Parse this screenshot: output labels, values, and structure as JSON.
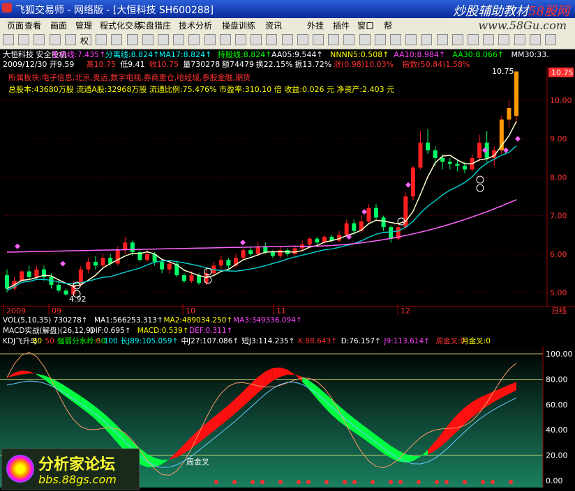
{
  "window": {
    "title": "飞狐交易师 - 网络版 - [大恒科技 SH600288]",
    "watermark_a": "炒股辅助教材",
    "watermark_b": "58股网"
  },
  "menu": {
    "items": [
      "页面",
      "查看",
      "画面",
      "管理",
      "程式化交易",
      "实盘猎庄",
      "技术分析",
      "操盘训练",
      "资讯",
      "外挂",
      "插件",
      "窗口",
      "帮"
    ],
    "url": "www.58Gu.com"
  },
  "toolbar": {
    "quanlabel": "权"
  },
  "header": {
    "line1": [
      {
        "t": "大恒科技 安全投机",
        "c": "#ffffff"
      },
      {
        "t": "生命线:7.435↑",
        "c": "#ff44ff"
      },
      {
        "t": "分离线:8.824↑",
        "c": "#00ffff"
      },
      {
        "t": "MA17:8.824↑",
        "c": "#00ffff"
      },
      {
        "t": "持股线:8.824↑",
        "c": "#00ff00"
      },
      {
        "t": "AA05:9.544↑",
        "c": "#ffffff"
      },
      {
        "t": "NNNN5:0.508↑",
        "c": "#ffff00"
      },
      {
        "t": "AA10:8.984↑",
        "c": "#ff44ff"
      },
      {
        "t": "AA30:8.066↑",
        "c": "#00ff00"
      },
      {
        "t": "MM30:33.",
        "c": "#ffffff"
      }
    ],
    "line2": [
      {
        "t": "2009/12/30 开9.59",
        "c": "#ffffff"
      },
      {
        "t": "高10.75",
        "c": "#ff3030"
      },
      {
        "t": "低9.41",
        "c": "#ffffff"
      },
      {
        "t": "收10.75",
        "c": "#ff3030"
      },
      {
        "t": "量730278",
        "c": "#ffffff"
      },
      {
        "t": "额74479",
        "c": "#ffffff"
      },
      {
        "t": "换22.15%",
        "c": "#ffffff"
      },
      {
        "t": "振13.72%",
        "c": "#ffffff"
      },
      {
        "t": "涨(0.98)10.03%",
        "c": "#ff3030"
      },
      {
        "t": "指数(50.84)1.58%",
        "c": "#ff3030"
      }
    ],
    "line3": "所属板块:电子信息,北京,奥运,数字电视,券商重仓,哈经城,参股金融,期货",
    "line4": "总股本:43680万股   流通A股:32968万股   流通比例:75.476%   市盈率:310.10 倍   收益:0.026 元   净资产:2.403 元"
  },
  "price_axis": {
    "labels": [
      "10.00",
      "9.00",
      "8.00",
      "7.00",
      "6.00",
      "5.00"
    ],
    "current": "10.75"
  },
  "annotations": {
    "high": "10.75",
    "low": "4.92"
  },
  "time_axis": {
    "labels": [
      "2009",
      "09",
      "10",
      "11",
      "12"
    ],
    "right": "日线"
  },
  "indicators": {
    "vol": [
      {
        "t": "VOL(5,10,35) 730278↑",
        "c": "#ffffff"
      },
      {
        "t": "MA1:566253.313↑",
        "c": "#ffffff"
      },
      {
        "t": "MA2:489034.250↑",
        "c": "#ffff00"
      },
      {
        "t": "MA3:349336.094↑",
        "c": "#ff44ff"
      }
    ],
    "macd": [
      {
        "t": "MACD实战(解盘)(26,12,9)",
        "c": "#ffffff"
      },
      {
        "t": "DIF:0.695↑",
        "c": "#ffffff"
      },
      {
        "t": "MACD:0.539↑",
        "c": "#ffff00"
      },
      {
        "t": "DEF:0.311↑",
        "c": "#ff44ff"
      }
    ],
    "kdj": [
      {
        "t": "KDJ飞升马",
        "c": "#ffffff"
      },
      {
        "t": "80",
        "c": "#ffff00"
      },
      {
        "t": "50",
        "c": "#ff3030"
      },
      {
        "t": "强弱分水岭:50",
        "c": "#00ff00"
      },
      {
        "t": "0",
        "c": "#ff3030"
      },
      {
        "t": "100",
        "c": "#00ffff"
      },
      {
        "t": "长J89:105.059↑",
        "c": "#00ffff"
      },
      {
        "t": "中J27:107.086↑",
        "c": "#ffffff"
      },
      {
        "t": "短J3:114.235↑",
        "c": "#ffffff"
      },
      {
        "t": "K:88.643↑",
        "c": "#ff3030"
      },
      {
        "t": "D:76.157↑",
        "c": "#ffffff"
      },
      {
        "t": "J9:113.614↑",
        "c": "#ff44ff"
      },
      {
        "t": "周金叉:0",
        "c": "#ff3030"
      },
      {
        "t": "月金叉:0",
        "c": "#ffff00"
      }
    ],
    "kdj_axis": [
      "100.00",
      "80.00",
      "60.00",
      "40.00",
      "20.00",
      "0.00"
    ],
    "golden_cross_label": "周金叉"
  },
  "bottom_watermark": {
    "t1": "分析家论坛",
    "t2": "bbs.88gs.com"
  },
  "colors": {
    "up": "#ff2020",
    "down": "#00c8c8",
    "bg": "#000000",
    "grid": "#800000"
  },
  "chart_data": {
    "type": "candlestick",
    "title": "大恒科技 SH600288",
    "candles": [
      [
        5.45,
        5.1,
        5.6,
        5.0
      ],
      [
        5.1,
        5.3,
        5.4,
        5.05
      ],
      [
        5.3,
        5.55,
        5.6,
        5.25
      ],
      [
        5.55,
        5.4,
        5.7,
        5.35
      ],
      [
        5.4,
        5.6,
        5.7,
        5.35
      ],
      [
        5.6,
        5.4,
        5.7,
        5.3
      ],
      [
        5.4,
        5.2,
        5.5,
        5.1
      ],
      [
        5.2,
        5.05,
        5.3,
        5.0
      ],
      [
        5.05,
        4.95,
        5.1,
        4.92
      ],
      [
        4.95,
        5.2,
        5.3,
        4.92
      ],
      [
        5.2,
        5.6,
        5.7,
        5.15
      ],
      [
        5.6,
        5.8,
        5.9,
        5.5
      ],
      [
        5.8,
        5.7,
        5.95,
        5.6
      ],
      [
        5.7,
        5.9,
        6.0,
        5.65
      ],
      [
        5.9,
        5.75,
        6.0,
        5.7
      ],
      [
        5.75,
        6.1,
        6.2,
        5.7
      ],
      [
        6.1,
        6.3,
        6.45,
        6.0
      ],
      [
        6.3,
        6.05,
        6.35,
        5.95
      ],
      [
        6.05,
        5.85,
        6.1,
        5.8
      ],
      [
        5.85,
        6.0,
        6.1,
        5.8
      ],
      [
        6.0,
        5.8,
        6.05,
        5.7
      ],
      [
        5.8,
        5.6,
        5.85,
        5.5
      ],
      [
        5.6,
        5.75,
        5.85,
        5.5
      ],
      [
        5.75,
        5.45,
        5.8,
        5.4
      ],
      [
        5.45,
        5.3,
        5.5,
        5.25
      ],
      [
        5.3,
        5.45,
        5.55,
        5.25
      ],
      [
        5.45,
        5.25,
        5.5,
        5.2
      ],
      [
        5.25,
        5.5,
        5.6,
        5.2
      ],
      [
        5.5,
        5.7,
        5.8,
        5.45
      ],
      [
        5.7,
        5.85,
        5.95,
        5.6
      ],
      [
        5.85,
        5.7,
        5.9,
        5.6
      ],
      [
        5.7,
        5.9,
        6.0,
        5.65
      ],
      [
        5.9,
        6.1,
        6.15,
        5.85
      ],
      [
        6.1,
        6.0,
        6.2,
        5.95
      ],
      [
        6.0,
        6.2,
        6.3,
        5.95
      ],
      [
        6.2,
        6.05,
        6.3,
        6.0
      ],
      [
        6.05,
        5.95,
        6.1,
        5.9
      ],
      [
        5.95,
        6.1,
        6.2,
        5.9
      ],
      [
        6.1,
        6.0,
        6.15,
        5.95
      ],
      [
        6.0,
        6.15,
        6.2,
        5.95
      ],
      [
        6.15,
        6.25,
        6.35,
        6.1
      ],
      [
        6.25,
        6.4,
        6.45,
        6.2
      ],
      [
        6.4,
        6.3,
        6.45,
        6.2
      ],
      [
        6.3,
        6.45,
        6.5,
        6.25
      ],
      [
        6.45,
        6.35,
        6.5,
        6.3
      ],
      [
        6.35,
        6.5,
        6.6,
        6.3
      ],
      [
        6.5,
        6.8,
        6.9,
        6.45
      ],
      [
        6.8,
        6.6,
        6.9,
        6.5
      ],
      [
        6.6,
        6.85,
        7.0,
        6.55
      ],
      [
        6.85,
        7.2,
        7.3,
        6.8
      ],
      [
        7.2,
        6.95,
        7.3,
        6.9
      ],
      [
        6.95,
        6.7,
        7.0,
        6.6
      ],
      [
        6.7,
        6.4,
        6.75,
        6.3
      ],
      [
        6.4,
        6.7,
        6.8,
        6.35
      ],
      [
        6.7,
        7.5,
        7.6,
        6.65
      ],
      [
        7.5,
        8.25,
        8.3,
        7.4
      ],
      [
        8.25,
        8.9,
        9.2,
        8.2
      ],
      [
        8.9,
        8.7,
        9.25,
        8.6
      ],
      [
        8.7,
        8.5,
        8.8,
        8.3
      ],
      [
        8.5,
        8.4,
        8.6,
        8.2
      ],
      [
        8.4,
        8.35,
        8.5,
        8.2
      ],
      [
        8.35,
        8.3,
        8.45,
        8.15
      ],
      [
        8.3,
        8.2,
        8.4,
        8.1
      ],
      [
        8.2,
        8.5,
        8.6,
        8.15
      ],
      [
        8.5,
        8.9,
        9.1,
        8.4
      ],
      [
        8.9,
        8.5,
        9.2,
        8.4
      ],
      [
        8.5,
        8.7,
        8.8,
        8.3
      ],
      [
        8.7,
        9.5,
        9.6,
        8.6
      ],
      [
        9.5,
        9.8,
        10.0,
        9.3
      ],
      [
        9.59,
        10.75,
        10.75,
        9.41
      ]
    ]
  }
}
